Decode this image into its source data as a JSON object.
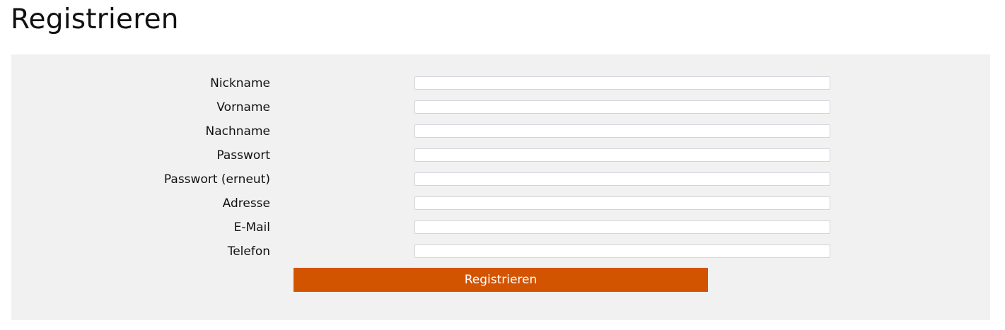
{
  "page": {
    "title": "Registrieren"
  },
  "form": {
    "fields": [
      {
        "label": "Nickname",
        "value": ""
      },
      {
        "label": "Vorname",
        "value": ""
      },
      {
        "label": "Nachname",
        "value": ""
      },
      {
        "label": "Passwort",
        "value": ""
      },
      {
        "label": "Passwort (erneut)",
        "value": ""
      },
      {
        "label": "Adresse",
        "value": ""
      },
      {
        "label": "E-Mail",
        "value": ""
      },
      {
        "label": "Telefon",
        "value": ""
      }
    ],
    "submit_label": "Registrieren"
  },
  "colors": {
    "panel_background": "#f1f1f2",
    "button_background": "#d35400",
    "button_text": "#ffffff"
  }
}
